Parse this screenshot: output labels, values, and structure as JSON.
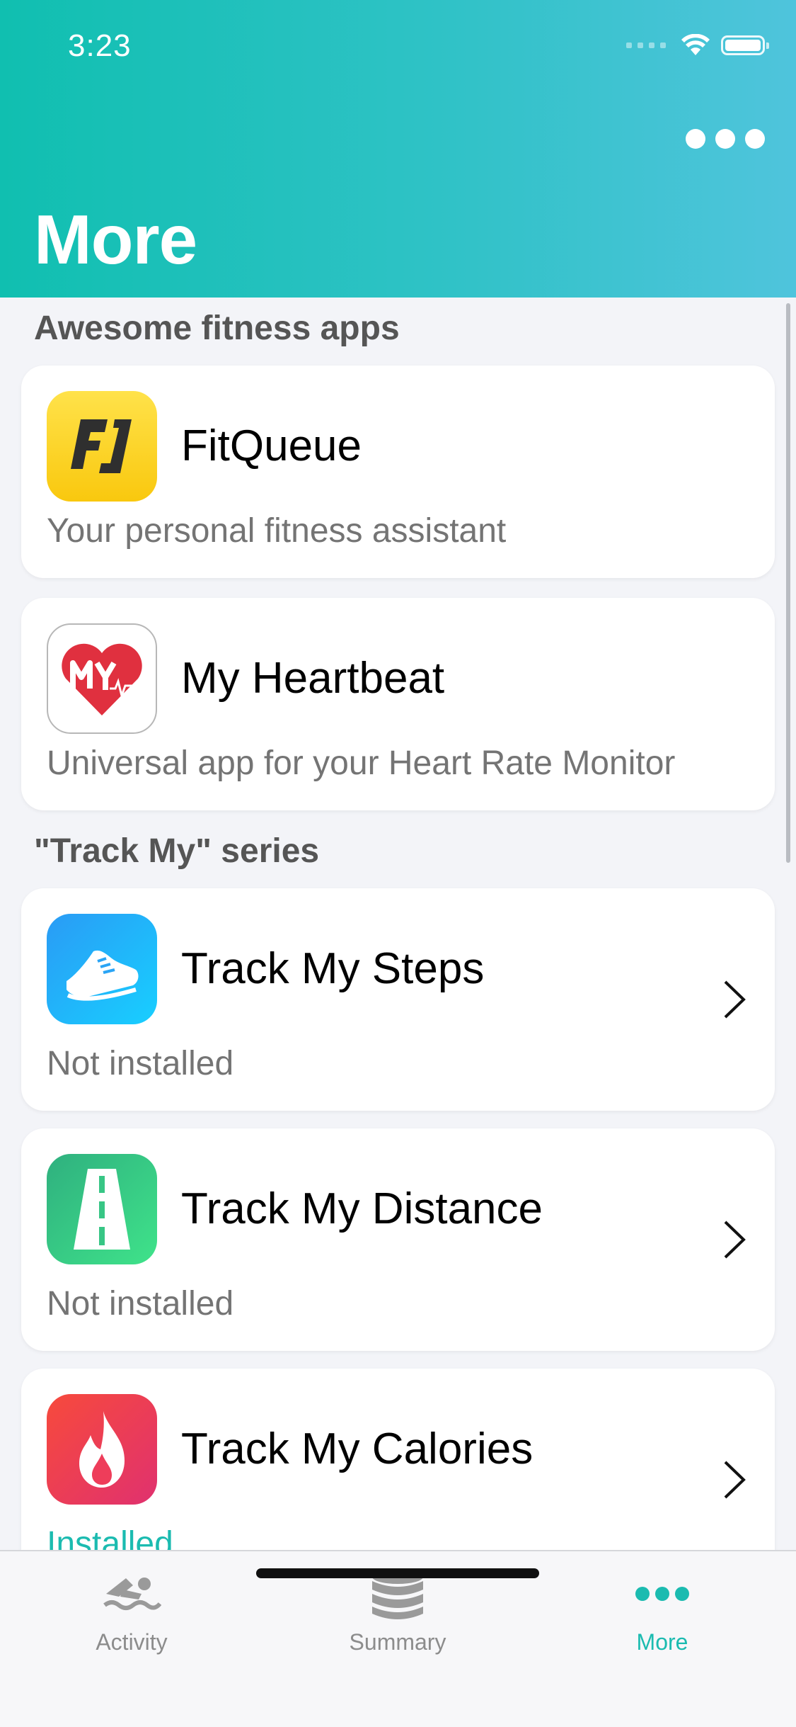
{
  "status_bar": {
    "time": "3:23"
  },
  "header": {
    "title": "More"
  },
  "sections": {
    "fitness": {
      "title": "Awesome fitness apps",
      "apps": [
        {
          "name": "FitQueue",
          "subtitle": "Your personal fitness assistant"
        },
        {
          "name": "My Heartbeat",
          "subtitle": "Universal app for your Heart Rate Monitor"
        }
      ]
    },
    "track_my": {
      "title": "\"Track My\" series",
      "apps": [
        {
          "name": "Track My Steps",
          "status": "Not installed"
        },
        {
          "name": "Track My Distance",
          "status": "Not installed"
        },
        {
          "name": "Track My Calories",
          "status": "Installed"
        }
      ]
    }
  },
  "tabbar": {
    "tabs": [
      {
        "label": "Activity"
      },
      {
        "label": "Summary"
      },
      {
        "label": "More"
      }
    ],
    "active_color": "#1bbbb0",
    "inactive_color": "#8c8c8c"
  },
  "colors": {
    "header_start": "#10bfb0",
    "header_end": "#4fc4dc",
    "installed": "#1bbbb0"
  }
}
